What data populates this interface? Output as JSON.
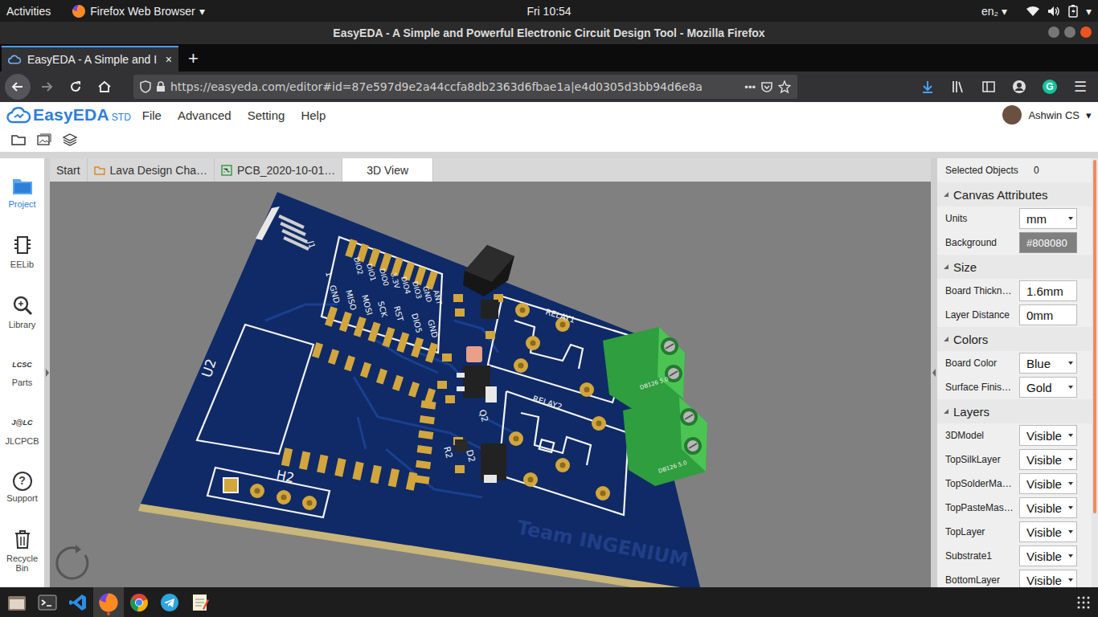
{
  "os": {
    "activities": "Activities",
    "app": "Firefox Web Browser",
    "app_caret": "▾",
    "clock": "Fri 10:54",
    "lang": "en₂",
    "lang_caret": "▾",
    "power_caret": "▾"
  },
  "window": {
    "title": "EasyEDA - A Simple and Powerful Electronic Circuit Design Tool - Mozilla Firefox"
  },
  "browser_tabs": [
    {
      "label": "EasyEDA - A Simple and I",
      "close": "×",
      "selected": true
    }
  ],
  "new_tab": "+",
  "url": {
    "text": "https://easyeda.com/editor#id=87e597d9e2a44ccfa8db2363d6fbae1a|e4d0305d3bb94d6e8a",
    "more": "•••"
  },
  "toolbar_right": {
    "grammarly": "G",
    "menu": "☰"
  },
  "app": {
    "logo": "EasyEDA",
    "edition": "STD",
    "menu": [
      "File",
      "Advanced",
      "Setting",
      "Help"
    ],
    "user": "Ashwin CS",
    "user_caret": "▾"
  },
  "sidebar": [
    {
      "label": "Project",
      "kind": "project",
      "selected": true
    },
    {
      "label": "EELib",
      "kind": "eelib",
      "selected": false
    },
    {
      "label": "Library",
      "kind": "library",
      "selected": false
    },
    {
      "label": "Parts",
      "kind": "parts",
      "icon_text": "LCSC",
      "selected": false
    },
    {
      "label": "JLCPCB",
      "kind": "jlcpcb",
      "icon_text": "J@LC",
      "selected": false
    },
    {
      "label": "Support",
      "kind": "support",
      "icon_text": "?",
      "selected": false
    },
    {
      "label": "Recycle Bin",
      "kind": "bin",
      "selected": false
    }
  ],
  "doc_tabs": [
    {
      "label": "Start",
      "kind": "plain",
      "selected": false
    },
    {
      "label": "Lava Design Cha…",
      "kind": "folder",
      "selected": false
    },
    {
      "label": "PCB_2020-10-01…",
      "kind": "pcb",
      "selected": false
    },
    {
      "label": "3D View",
      "kind": "plain",
      "selected": true
    }
  ],
  "panel": {
    "selected_label": "Selected Objects",
    "selected_count": "0",
    "sections": [
      {
        "title": "Canvas Attributes",
        "expanded": true,
        "rows": [
          {
            "label": "Units",
            "value": "mm",
            "kind": "select"
          },
          {
            "label": "Background",
            "value": "#808080",
            "kind": "color"
          }
        ]
      },
      {
        "title": "Size",
        "expanded": true,
        "rows": [
          {
            "label": "Board Thickn…",
            "value": "1.6mm",
            "kind": "input"
          },
          {
            "label": "Layer Distance",
            "value": "0mm",
            "kind": "input"
          }
        ]
      },
      {
        "title": "Colors",
        "expanded": true,
        "rows": [
          {
            "label": "Board Color",
            "value": "Blue",
            "kind": "select"
          },
          {
            "label": "Surface Finis…",
            "value": "Gold",
            "kind": "select"
          }
        ]
      },
      {
        "title": "Layers",
        "expanded": true,
        "rows": [
          {
            "label": "3DModel",
            "value": "Visible",
            "kind": "select"
          },
          {
            "label": "TopSilkLayer",
            "value": "Visible",
            "kind": "select"
          },
          {
            "label": "TopSolderMa…",
            "value": "Visible",
            "kind": "select"
          },
          {
            "label": "TopPasteMas…",
            "value": "Visible",
            "kind": "select"
          },
          {
            "label": "TopLayer",
            "value": "Visible",
            "kind": "select"
          },
          {
            "label": "Substrate1",
            "value": "Visible",
            "kind": "select"
          },
          {
            "label": "BottomLayer",
            "value": "Visible",
            "kind": "select"
          }
        ]
      }
    ]
  },
  "pcb": {
    "board_color": "#0f2a66",
    "finish_color": "#d2a63c",
    "labels": [
      "1",
      "GND",
      "MISO",
      "MOSI",
      "SCK",
      "RST",
      "DIO5",
      "GND",
      "DIO2",
      "DIO1",
      "DIO0",
      "3.3V",
      "DIO4",
      "DIO3",
      "GND",
      "ANT",
      "J1",
      "U2",
      "H2",
      "RELAY1",
      "RELAY2",
      "R2",
      "D2",
      "Q2",
      "Team INGENIUM",
      "DB126 5.0",
      "DB126 5.0"
    ]
  },
  "taskbar": [
    {
      "kind": "files",
      "selected": false
    },
    {
      "kind": "terminal",
      "selected": false
    },
    {
      "kind": "vscode",
      "selected": false
    },
    {
      "kind": "firefox",
      "selected": true
    },
    {
      "kind": "chrome",
      "selected": false
    },
    {
      "kind": "telegram",
      "selected": false
    },
    {
      "kind": "editor",
      "selected": false
    }
  ]
}
